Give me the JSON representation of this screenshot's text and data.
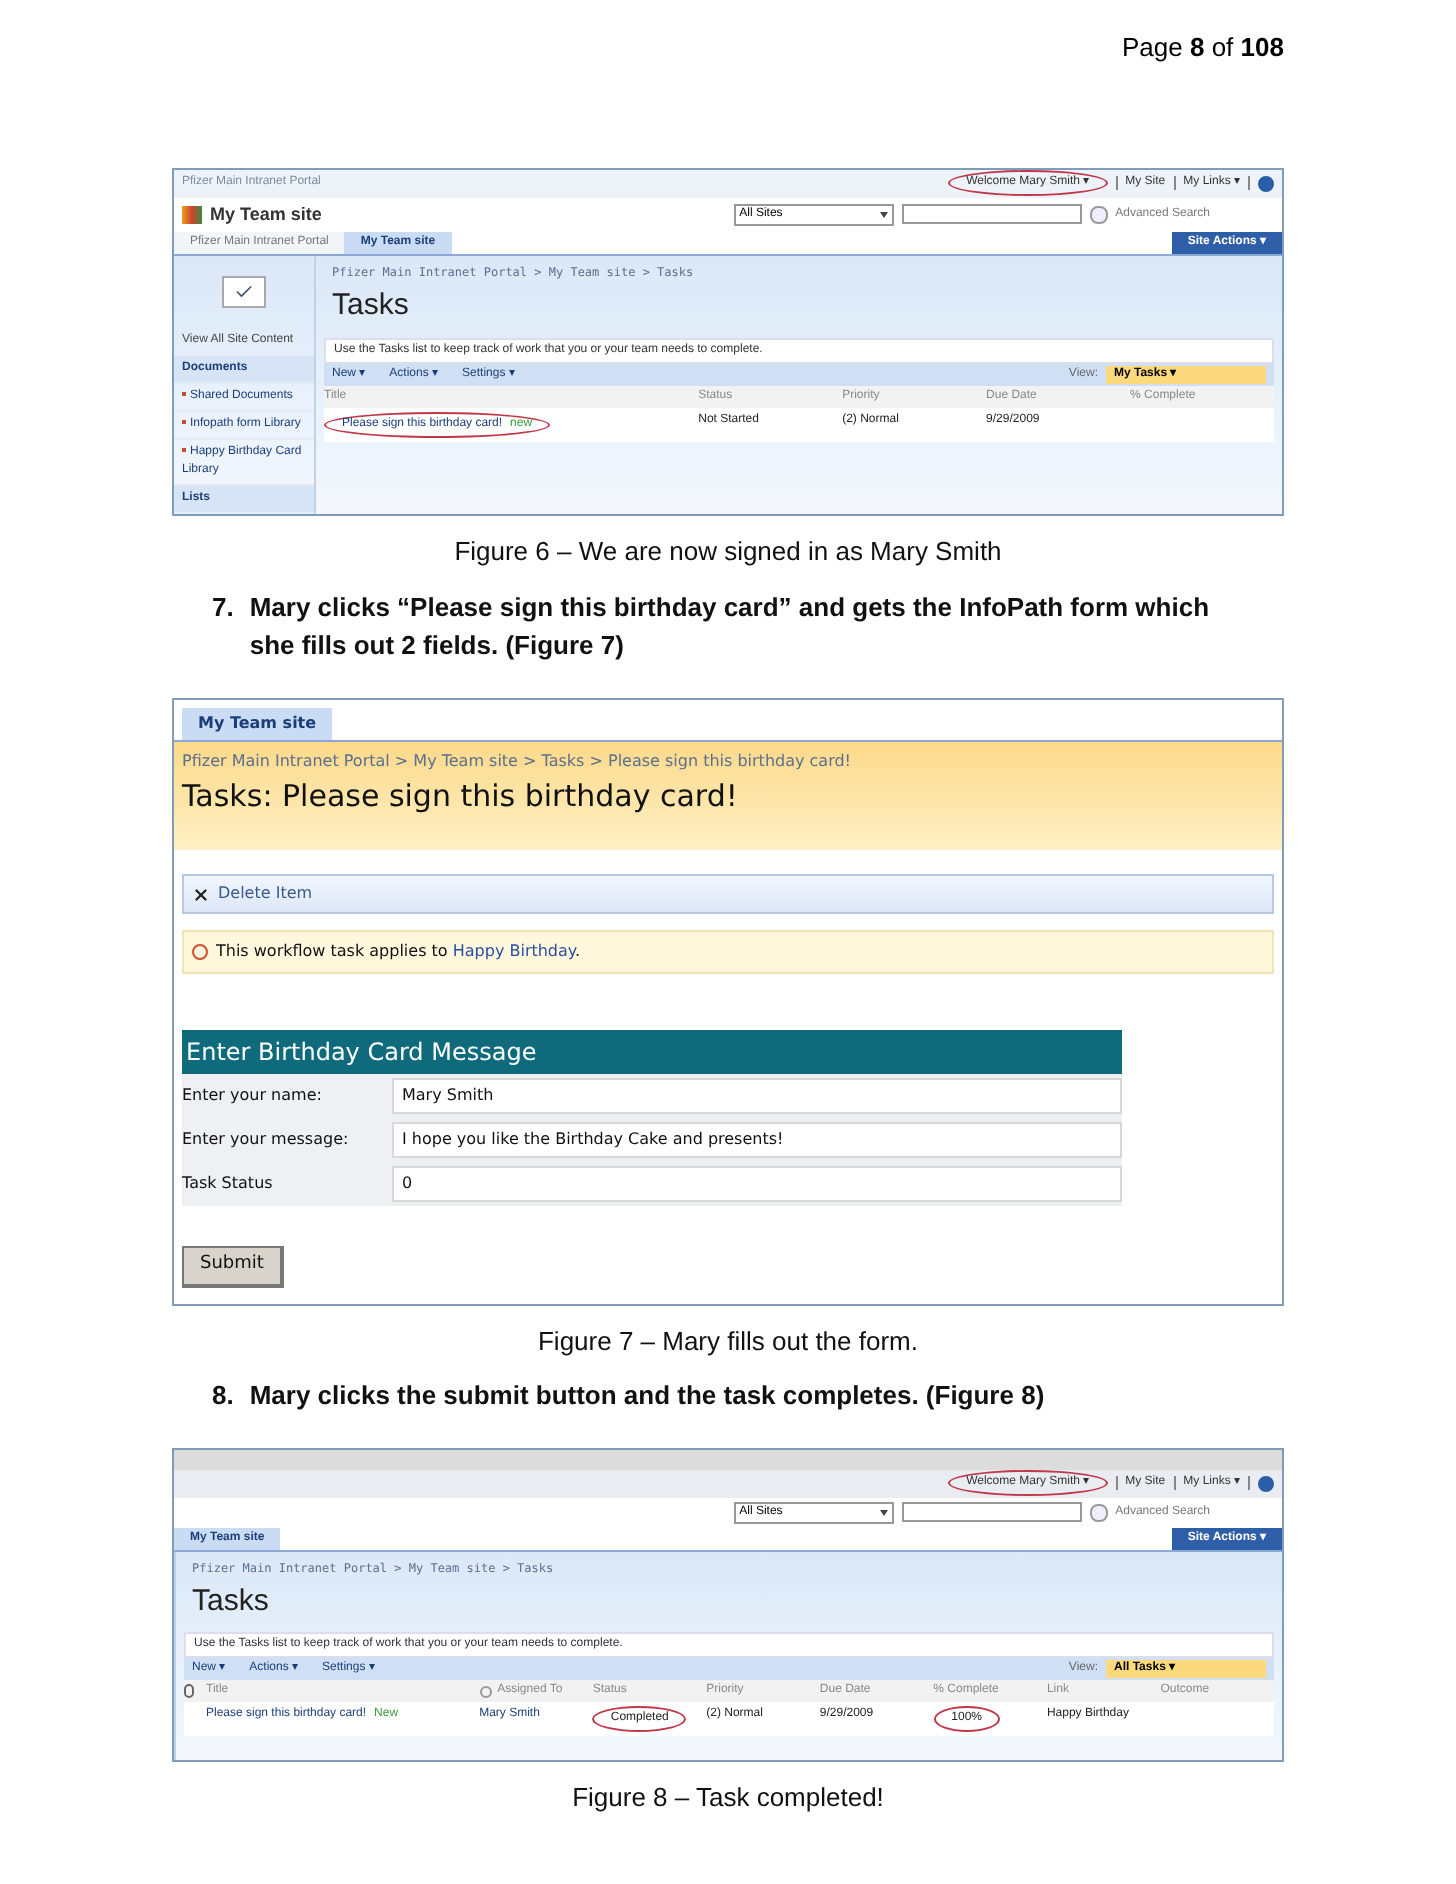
{
  "page_number": "Page **8** of **108**",
  "figure_6": {
    "portal_title": "Pfizer Main Intranet Portal",
    "welcome": {
      "text": "Welcome Mary Smith ▾",
      "circled": true
    },
    "my_site": "My Site",
    "my_links": "My Links ▾",
    "site_title": "My Team site",
    "search_scope": "All Sites",
    "advanced_search": "Advanced Search",
    "tabs": [
      {
        "label": "Pfizer Main Intranet Portal",
        "selected": false
      },
      {
        "label": "My Team site",
        "selected": true
      }
    ],
    "site_actions": "Site Actions ▾",
    "breadcrumb": "Pfizer Main Intranet Portal > My Team site > Tasks",
    "page_title": "Tasks",
    "quick_launch": [
      {
        "kind": "link",
        "label": "View All Site Content"
      },
      {
        "kind": "heading",
        "label": "Documents"
      },
      {
        "kind": "bullet",
        "label": "Shared Documents"
      },
      {
        "kind": "bullet",
        "label": "Infopath form Library"
      },
      {
        "kind": "bullet",
        "label": "Happy Birthday Card Library"
      },
      {
        "kind": "heading",
        "label": "Lists"
      }
    ],
    "description": "Use the Tasks list to keep track of work that you or your team needs to complete.",
    "toolbar": [
      "New ▾",
      "Actions ▾",
      "Settings ▾"
    ],
    "view_label": "View:",
    "view": "My Tasks ▾",
    "columns": [
      {
        "kind": "title",
        "label": "Title"
      },
      {
        "kind": "text",
        "label": "Status"
      },
      {
        "kind": "text",
        "label": "Priority"
      },
      {
        "kind": "text",
        "label": "Due Date"
      },
      {
        "kind": "text",
        "label": "% Complete"
      }
    ],
    "rows": [
      {
        "new_badge": "new",
        "cells": [
          {
            "text": "Please sign this birthday card!",
            "circled": true
          },
          {
            "text": "Not Started",
            "circled": false
          },
          {
            "text": "(2) Normal",
            "circled": false
          },
          {
            "text": "9/29/2009",
            "circled": false
          }
        ]
      }
    ]
  },
  "caption_6": "Figure 6 – We are now signed in as Mary Smith",
  "step_7": {
    "number": "7.",
    "text": "Mary clicks “Please sign this birthday card” and gets the InfoPath form which she fills out 2 fields. (Figure 7)"
  },
  "figure_7": {
    "tab": {
      "label": "My Team site",
      "selected": true
    },
    "breadcrumb": "Pfizer Main Intranet Portal > My Team site > Tasks > Please sign this birthday card!",
    "page_title": "Tasks: Please sign this birthday card!",
    "delete_item": "Delete Item",
    "notice": "This workflow task applies to",
    "notice_link": "Happy Birthday",
    "notice_end": ".",
    "form_title": "Enter Birthday Card Message",
    "fields": [
      {
        "label": "Enter your name:",
        "value": "Mary Smith"
      },
      {
        "label": "Enter your message:",
        "value": "I hope you like the Birthday Cake and presents!"
      },
      {
        "label": "Task Status",
        "value": "0"
      }
    ],
    "submit": "Submit"
  },
  "caption_7": "Figure 7 – Mary fills out the form.",
  "step_8": {
    "number": "8.",
    "text": "Mary clicks the submit button and the task completes.  (Figure 8)"
  },
  "figure_8": {
    "welcome": {
      "text": "Welcome Mary Smith ▾",
      "circled": true
    },
    "my_site": "My Site",
    "my_links": "My Links ▾",
    "search_scope": "All Sites",
    "advanced_search": "Advanced Search",
    "tabs": [
      {
        "label": "My Team site",
        "selected": true
      }
    ],
    "site_actions": "Site Actions ▾",
    "breadcrumb": "Pfizer Main Intranet Portal > My Team site > Tasks",
    "page_title": "Tasks",
    "description": "Use the Tasks list to keep track of work that you or your team needs to complete.",
    "toolbar": [
      "New ▾",
      "Actions ▾",
      "Settings ▾"
    ],
    "view_label": "View:",
    "view": "All Tasks ▾",
    "attachment_icon": true,
    "columns": [
      {
        "kind": "title",
        "label": "Title"
      },
      {
        "kind": "user",
        "label": "Assigned To"
      },
      {
        "kind": "text",
        "label": "Status"
      },
      {
        "kind": "text",
        "label": "Priority"
      },
      {
        "kind": "text",
        "label": "Due Date"
      },
      {
        "kind": "text",
        "label": "% Complete"
      },
      {
        "kind": "text",
        "label": "Link"
      },
      {
        "kind": "text",
        "label": "Outcome"
      }
    ],
    "rows": [
      {
        "new_badge": "New",
        "cells": [
          {
            "text": "Please sign this birthday card!",
            "circled": false
          },
          {
            "text": "Mary Smith",
            "circled": false
          },
          {
            "text": "Completed",
            "circled": true
          },
          {
            "text": "(2) Normal",
            "circled": false
          },
          {
            "text": "9/29/2009",
            "circled": false
          },
          {
            "text": "100%",
            "circled": true
          },
          {
            "text": "Happy Birthday",
            "circled": false
          }
        ]
      }
    ]
  },
  "caption_8": "Figure 8 – Task completed!"
}
